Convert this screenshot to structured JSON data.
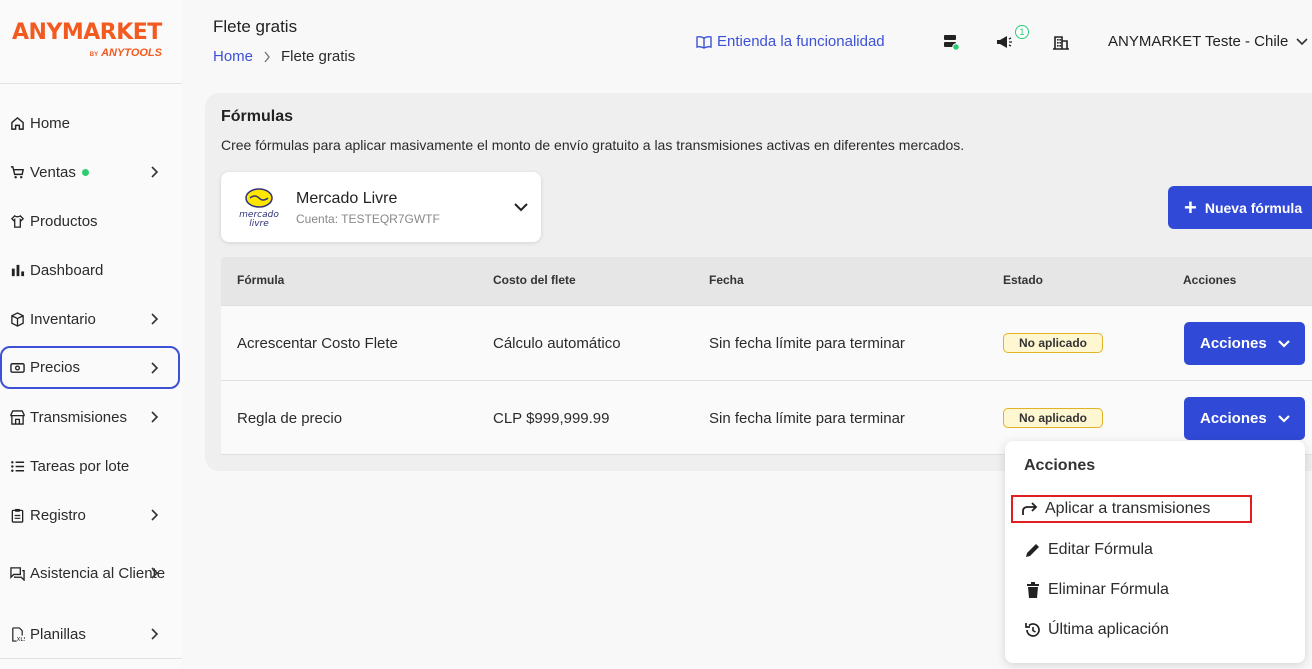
{
  "brand": {
    "logo_main": "ANYMARKET",
    "logo_by": "BY",
    "logo_sub": "ANYTOOLS"
  },
  "sidebar": {
    "items": [
      {
        "label": "Home",
        "icon": "home-icon"
      },
      {
        "label": "Ventas",
        "icon": "cart-icon",
        "dot": true
      },
      {
        "label": "Productos",
        "icon": "shirt-icon"
      },
      {
        "label": "Dashboard",
        "icon": "bar-chart-icon"
      },
      {
        "label": "Inventario",
        "icon": "box-icon"
      },
      {
        "label": "Precios",
        "icon": "money-icon",
        "active": true
      },
      {
        "label": "Transmisiones",
        "icon": "store-icon"
      },
      {
        "label": "Tareas por lote",
        "icon": "list-icon"
      },
      {
        "label": "Registro",
        "icon": "clipboard-icon"
      },
      {
        "label": "Asistencia al Cliente",
        "icon": "chat-icon"
      },
      {
        "label": "Planillas",
        "icon": "spreadsheet-icon"
      }
    ]
  },
  "header": {
    "title": "Flete gratis",
    "breadcrumb_home": "Home",
    "breadcrumb_current": "Flete gratis",
    "help_link": "Entienda la funcionalidad",
    "notification_count": "1",
    "account": "ANYMARKET Teste - Chile"
  },
  "main": {
    "title": "Fórmulas",
    "description": "Cree fórmulas para aplicar masivamente el monto de envío gratuito a las transmisiones activas en diferentes mercados.",
    "marketplace": {
      "name": "Mercado Livre",
      "account": "Cuenta: TESTEQR7GWTF",
      "logo_text_1": "mercado",
      "logo_text_2": "livre"
    },
    "new_button": "Nueva fórmula",
    "table": {
      "headers": [
        "Fórmula",
        "Costo del flete",
        "Fecha",
        "Estado",
        "Acciones"
      ],
      "rows": [
        {
          "formula": "Acrescentar Costo Flete",
          "cost": "Cálculo automático",
          "date": "Sin fecha límite para terminar",
          "status": "No aplicado",
          "action": "Acciones"
        },
        {
          "formula": "Regla de precio",
          "cost": "CLP $999,999.99",
          "date": "Sin fecha límite para terminar",
          "status": "No aplicado",
          "action": "Acciones"
        }
      ]
    }
  },
  "menu": {
    "title": "Acciones",
    "items": [
      {
        "label": "Aplicar a transmisiones",
        "icon": "share-arrow-icon"
      },
      {
        "label": "Editar Fórmula",
        "icon": "pencil-icon"
      },
      {
        "label": "Eliminar Fórmula",
        "icon": "trash-icon"
      },
      {
        "label": "Última aplicación",
        "icon": "history-icon"
      }
    ]
  },
  "colors": {
    "brand": "#f25a1f",
    "primary": "#3049d7",
    "status_bg": "#fff7d1",
    "status_border": "#e2b324",
    "highlight": "#e02020"
  }
}
